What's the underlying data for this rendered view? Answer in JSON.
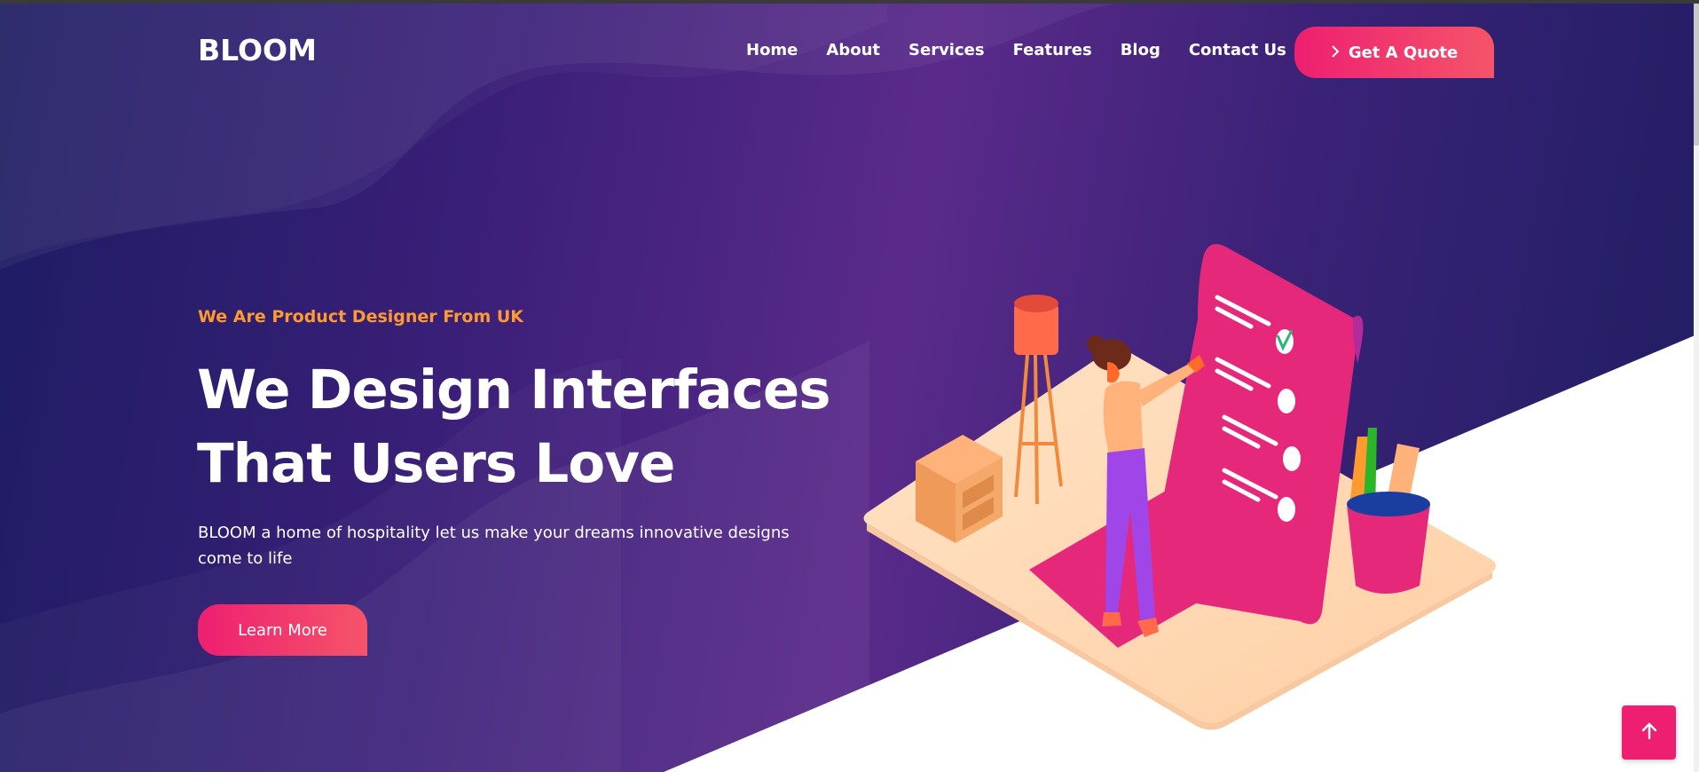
{
  "brand": {
    "logo": "BLOOM"
  },
  "nav": {
    "items": [
      "Home",
      "About",
      "Services",
      "Features",
      "Blog",
      "Contact Us"
    ],
    "cta_label": "Get A Quote"
  },
  "hero": {
    "tagline": "We Are Product Designer From UK",
    "headline_line1": "We Design Interfaces",
    "headline_line2": "That Users Love",
    "description": "BLOOM a home of hospitality let us make your dreams innovative designs come to life",
    "button_label": "Learn More"
  },
  "icons": {
    "cta_icon": "chevron-right-icon",
    "back_to_top_icon": "arrow-up-icon"
  },
  "colors": {
    "accent": "#ee1f70",
    "tagline": "#ff9a2f",
    "hero_bg": "#3a1f78"
  }
}
